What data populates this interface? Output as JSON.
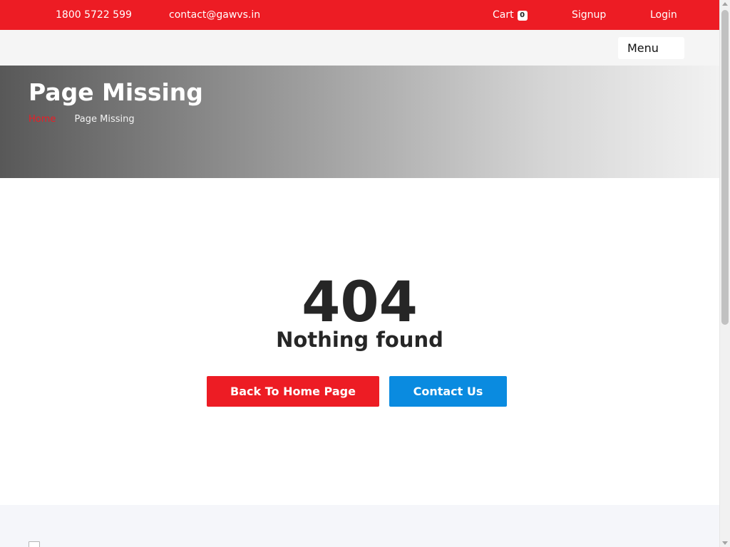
{
  "topbar": {
    "phone": "1800 5722 599",
    "email": "contact@gawvs.in",
    "cart_label": "Cart",
    "cart_count": "0",
    "signup_label": "Signup",
    "login_label": "Login",
    "bg_color": "#ed1c24"
  },
  "navbar": {
    "menu_label": "Menu"
  },
  "hero": {
    "title": "Page Missing",
    "breadcrumb": {
      "home": "Home",
      "current": "Page Missing"
    }
  },
  "error": {
    "code": "404",
    "message": "Nothing found",
    "home_button": "Back To Home Page",
    "contact_button": "Contact Us",
    "home_button_color": "#ed1c24",
    "contact_button_color": "#0a8be0"
  },
  "footer": {
    "logo_icon": "broken-image-icon"
  }
}
